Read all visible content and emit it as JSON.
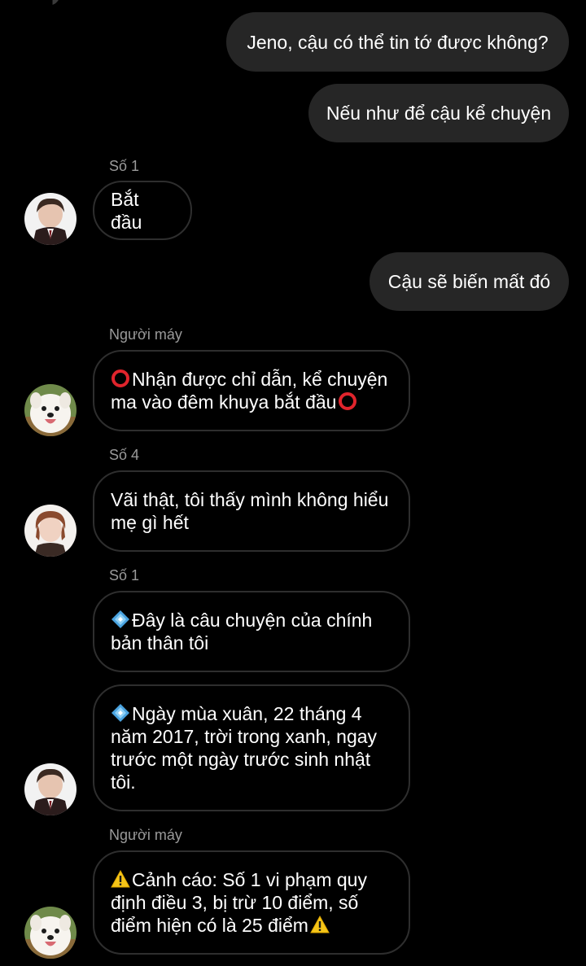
{
  "chat": {
    "outgoing": [
      "Jeno, cậu có thể tin tớ được không?",
      "Nếu như để cậu kể chuyện",
      "Cậu sẽ biến mất đó"
    ],
    "senders": {
      "so1_a": "Số 1",
      "robot_a": "Người máy",
      "so4": "Số 4",
      "so1_b": "Số 1",
      "robot_b": "Người máy"
    },
    "incoming": {
      "bat_dau": "Bắt đầu",
      "robot1": "Nhận được chỉ dẫn, kể chuyện ma vào đêm khuya bắt đầu",
      "so4_msg": "Vãi thật, tôi thấy mình không hiểu mẹ gì hết",
      "so1_msg1": "Đây là câu chuyện của chính bản thân tôi",
      "so1_msg2": "Ngày mùa xuân, 22 tháng 4 năm 2017, trời trong xanh, ngay trước một ngày trước sinh nhật tôi.",
      "robot2": "Cảnh cáo: Số 1 vi phạm quy định điều 3, bị trừ 10 điểm, số điểm hiện có là 25 điểm"
    },
    "icons": {
      "red_circle": "red-circle-icon",
      "diamond": "blue-diamond-icon",
      "warning": "warning-icon"
    }
  },
  "colors": {
    "background": "#000000",
    "outgoing_bubble": "#262626",
    "incoming_border": "#2e2e2e",
    "sender_label": "#9a9a9a"
  }
}
